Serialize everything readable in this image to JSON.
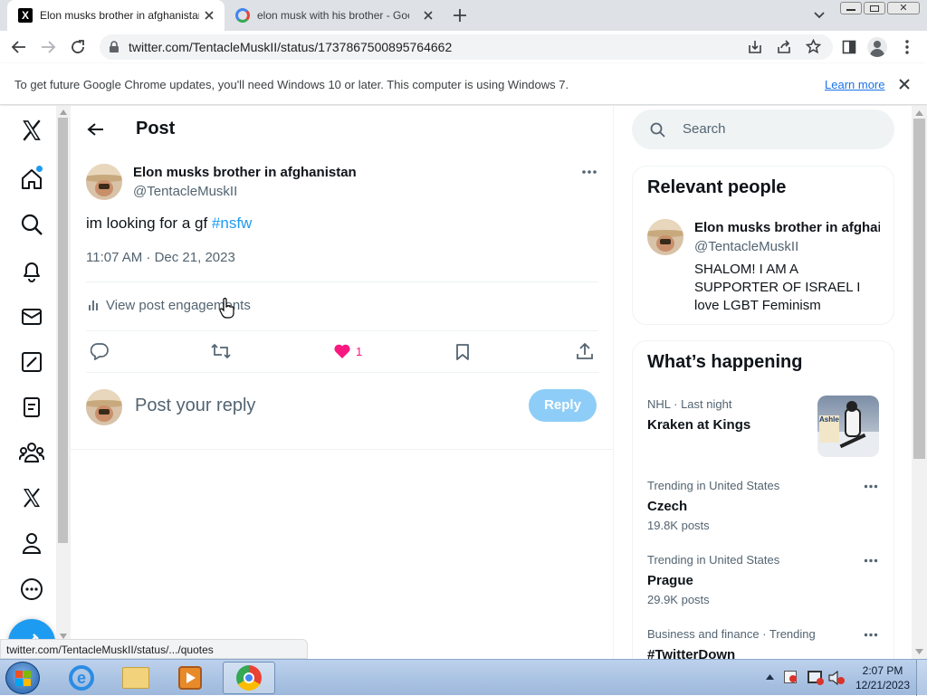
{
  "browser": {
    "tabs": [
      {
        "title": "Elon musks brother in afghanistan",
        "active": true
      },
      {
        "title": "elon musk with his brother - Google Search",
        "active": false
      }
    ],
    "url": "twitter.com/TentacleMuskII/status/1737867500895764662",
    "infobar": {
      "message": "To get future Google Chrome updates, you'll need Windows 10 or later. This computer is using Windows 7.",
      "link": "Learn more"
    },
    "status_url": "twitter.com/TentacleMuskII/status/.../quotes"
  },
  "header": {
    "title": "Post"
  },
  "post": {
    "author_name": "Elon musks brother in afghanistan",
    "handle": "@TentacleMuskII",
    "text": "im looking for a gf ",
    "hashtag": "#nsfw",
    "timestamp": "11:07 AM · Dec 21, 2023",
    "engagements_label": "View post engagements",
    "like_count": "1"
  },
  "reply": {
    "placeholder": "Post your reply",
    "button": "Reply"
  },
  "search": {
    "placeholder": "Search"
  },
  "relevant": {
    "title": "Relevant people",
    "name": "Elon musks brother in afghai",
    "handle": "@TentacleMuskII",
    "bio": "SHALOM! I AM A SUPPORTER OF ISRAEL I love LGBT Feminism"
  },
  "trends": {
    "title": "What’s happening",
    "items": [
      {
        "meta": "NHL · Last night",
        "name": "Kraken at Kings",
        "posts": ""
      },
      {
        "meta": "Trending in United States",
        "name": "Czech",
        "posts": "19.8K posts"
      },
      {
        "meta": "Trending in United States",
        "name": "Prague",
        "posts": "29.9K posts"
      },
      {
        "meta": "Business and finance · Trending",
        "name": "#TwitterDown",
        "posts": ""
      }
    ]
  },
  "taskbar": {
    "time": "2:07 PM",
    "date": "12/21/2023"
  },
  "colors": {
    "accent": "#1d9bf0",
    "like": "#f91880",
    "reply_button": "#8ecdf8"
  }
}
